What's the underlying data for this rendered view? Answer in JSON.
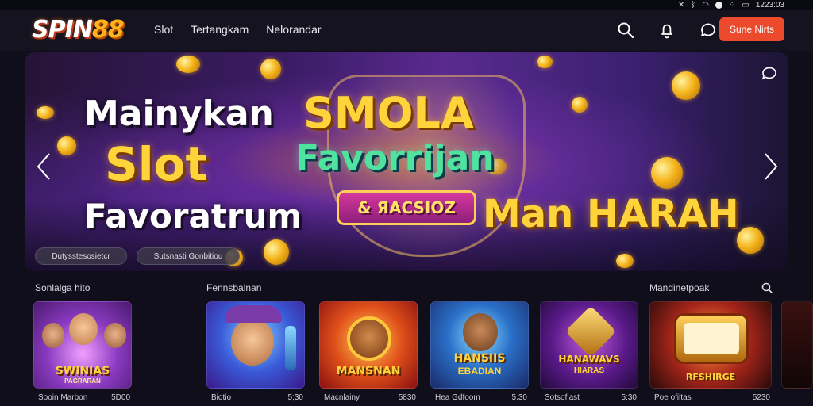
{
  "statusbar": {
    "time": "1223:03"
  },
  "header": {
    "logo_part1": "SPIN",
    "logo_part2": "88",
    "nav": [
      "Slot",
      "Tertangkam",
      "Nelorandar"
    ],
    "cta_label": "Sune Nirts"
  },
  "banner": {
    "line1": "Mainykan",
    "line2": "Slot",
    "line3": "Favoratrum",
    "center_title": "SMOLA",
    "center_sub": "Favorrijan",
    "ribbon": "& ЯACSIOZ",
    "right_title": "Man HARAH",
    "pill1": "Dutysstesosietcr",
    "pill2": "Sutsnasti Gonbitiou"
  },
  "sections": {
    "left": "Sonlalga hito",
    "middle": "Fennsbalnan",
    "right": "Mandinetpoak"
  },
  "games": [
    {
      "title": "SWINIAS",
      "sub": "PAGRARAN",
      "name": "Sooin Marbon",
      "value": "5D00",
      "bg1": "#6a2a9a",
      "bg2": "#c75ad8"
    },
    {
      "title": "",
      "sub": "",
      "name": "Biotio",
      "value": "5;30",
      "bg1": "#2b4fb0",
      "bg2": "#6a3ac8"
    },
    {
      "title": "MANSNAN",
      "sub": "",
      "name": "Macnlainy",
      "value": "5830",
      "bg1": "#b0201a",
      "bg2": "#f08a1a"
    },
    {
      "title": "HANSIIS",
      "sub": "EBADIAN",
      "name": "Hea Gdfoom",
      "value": "5.30",
      "bg1": "#1f3a8a",
      "bg2": "#2ea3d6"
    },
    {
      "title": "HANAWAVS",
      "sub": "HIARAS",
      "name": "Sotsofiast",
      "value": "5:30",
      "bg1": "#3a1a5a",
      "bg2": "#8a3aa8"
    },
    {
      "title": "RFSHIRGE",
      "sub": "",
      "name": "Poe ofiltas",
      "value": "5230",
      "bg1": "#3a1410",
      "bg2": "#c8461c"
    }
  ]
}
